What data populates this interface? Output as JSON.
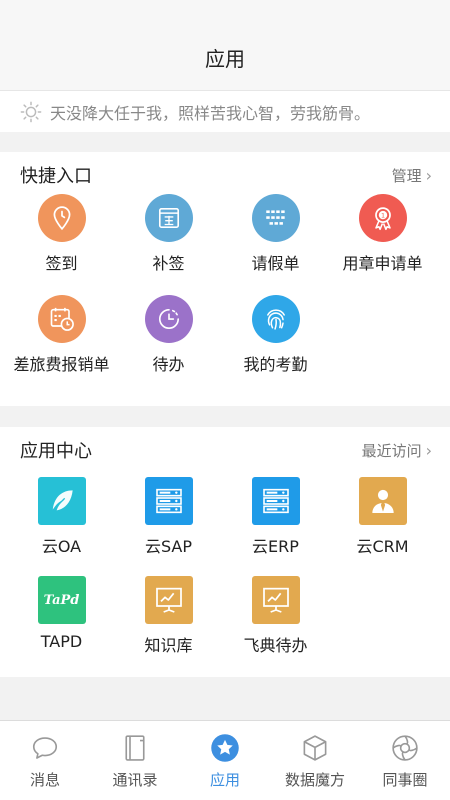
{
  "header": {
    "title": "应用"
  },
  "motto": {
    "text": "天没降大任于我，照样苦我心智，劳我筋骨。"
  },
  "quick": {
    "title": "快捷入口",
    "manage_label": "管理",
    "items": [
      {
        "label": "签到",
        "icon": "location-pin-icon",
        "color": "#f0955c"
      },
      {
        "label": "补签",
        "icon": "signing-form-icon",
        "color": "#5fa9d6"
      },
      {
        "label": "请假单",
        "icon": "list-grid-icon",
        "color": "#5fa9d6"
      },
      {
        "label": "用章申请单",
        "icon": "award-badge-icon",
        "color": "#f05b52"
      },
      {
        "label": "差旅费报销单",
        "icon": "calendar-clock-icon",
        "color": "#f0955c"
      },
      {
        "label": "待办",
        "icon": "clock-icon",
        "color": "#9b72c9"
      },
      {
        "label": "我的考勤",
        "icon": "fingerprint-icon",
        "color": "#2fa7e8"
      }
    ]
  },
  "app_center": {
    "title": "应用中心",
    "recent_label": "最近访问",
    "items": [
      {
        "label": "云OA",
        "icon": "feather-logo-icon",
        "color": "#26c0d6"
      },
      {
        "label": "云SAP",
        "icon": "server-rack-icon",
        "color": "#1f9be8"
      },
      {
        "label": "云ERP",
        "icon": "server-rack-icon",
        "color": "#1f9be8"
      },
      {
        "label": "云CRM",
        "icon": "person-tie-icon",
        "color": "#e2a94f"
      },
      {
        "label": "TAPD",
        "icon": "tapd-logo-icon",
        "color": "#2ec27e",
        "logo_text": "TaPd"
      },
      {
        "label": "知识库",
        "icon": "presentation-board-icon",
        "color": "#e2a94f"
      },
      {
        "label": "飞典待办",
        "icon": "presentation-board-icon",
        "color": "#e2a94f"
      }
    ]
  },
  "tabbar": {
    "items": [
      {
        "label": "消息",
        "icon": "chat-bubble-icon",
        "active": false
      },
      {
        "label": "通讯录",
        "icon": "address-book-icon",
        "active": false
      },
      {
        "label": "应用",
        "icon": "star-icon",
        "active": true
      },
      {
        "label": "数据魔方",
        "icon": "cube-icon",
        "active": false
      },
      {
        "label": "同事圈",
        "icon": "aperture-icon",
        "active": false
      }
    ],
    "active_color": "#3d8fe0"
  }
}
